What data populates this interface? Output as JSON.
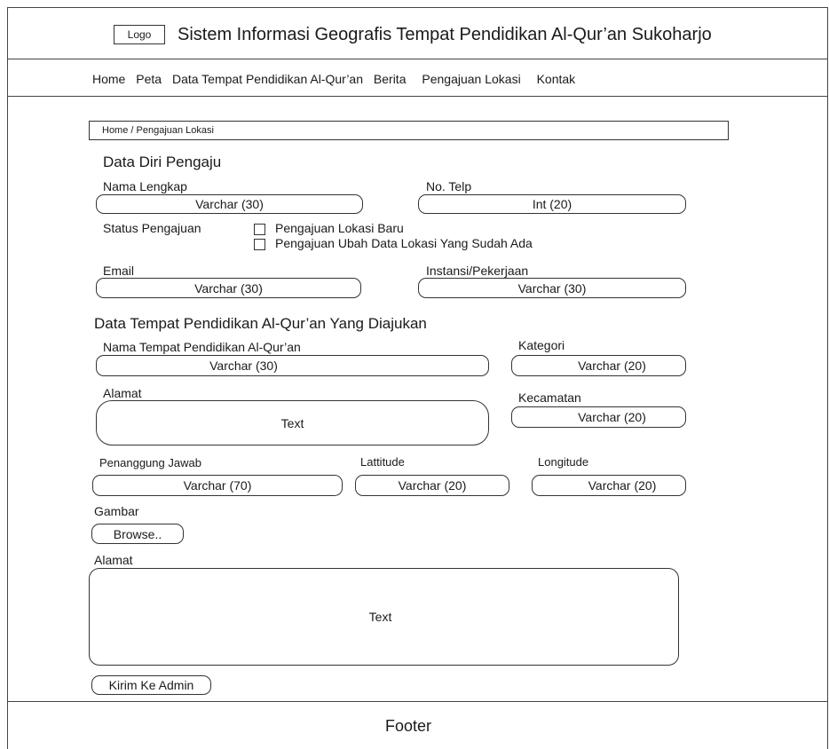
{
  "header": {
    "logo": "Logo",
    "title": "Sistem Informasi Geografis Tempat Pendidikan Al-Qur’an Sukoharjo"
  },
  "nav": {
    "items": [
      "Home",
      "Peta",
      "Data Tempat Pendidikan Al-Qur’an",
      "Berita",
      "Pengajuan Lokasi",
      "Kontak"
    ]
  },
  "breadcrumb": "Home / Pengajuan Lokasi",
  "section1": {
    "heading": "Data Diri Pengaju",
    "nama_label": "Nama Lengkap",
    "nama_value": "Varchar (30)",
    "telp_label": "No. Telp",
    "telp_value": "Int (20)",
    "status_label": "Status Pengajuan",
    "status_options": [
      "Pengajuan Lokasi Baru",
      "Pengajuan Ubah Data Lokasi Yang Sudah Ada"
    ],
    "email_label": "Email",
    "email_value": "Varchar (30)",
    "instansi_label": "Instansi/Pekerjaan",
    "instansi_value": "Varchar (30)"
  },
  "section2": {
    "heading": "Data Tempat Pendidikan Al-Qur’an Yang Diajukan",
    "nama_tempat_label": "Nama Tempat Pendidikan Al-Qur’an",
    "nama_tempat_value": "Varchar (30)",
    "kategori_label": "Kategori",
    "kategori_value": "Varchar (20)",
    "alamat_label": "Alamat",
    "alamat_value": "Text",
    "kecamatan_label": "Kecamatan",
    "kecamatan_value": "Varchar (20)",
    "pj_label": "Penanggung Jawab",
    "pj_value": "Varchar (70)",
    "lat_label": "Lattitude",
    "lat_value": "Varchar (20)",
    "lng_label": "Longitude",
    "lng_value": "Varchar (20)",
    "gambar_label": "Gambar",
    "browse_label": "Browse..",
    "alamat2_label": "Alamat",
    "alamat2_value": "Text",
    "submit_label": "Kirim Ke Admin"
  },
  "footer": "Footer"
}
